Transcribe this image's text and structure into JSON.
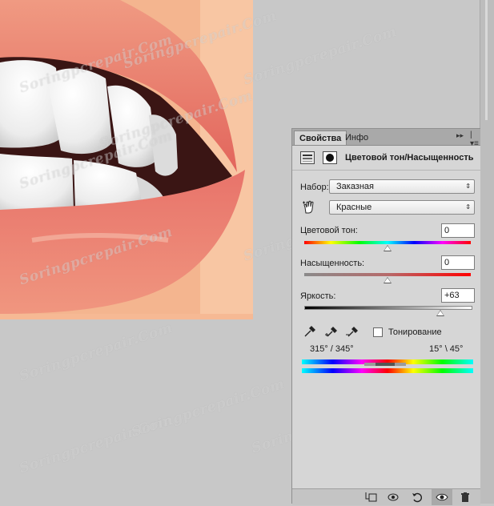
{
  "watermark_text": "Soringpcrepair.Com",
  "panel": {
    "tab_properties": "Свойства",
    "tab_info": "Инфо",
    "collapse_glyph": "▸▸",
    "menu_glyph": "|▾≡",
    "title": "Цветовой тон/Насыщенность",
    "preset_label": "Набор:",
    "preset_value": "Заказная",
    "channel_value": "Красные",
    "hue_label": "Цветовой тон:",
    "hue_value": "0",
    "saturation_label": "Насыщенность:",
    "saturation_value": "0",
    "lightness_label": "Яркость:",
    "lightness_value": "+63",
    "colorize_label": "Тонирование",
    "range_left": "315° / 345°",
    "range_right": "15° \\ 45°",
    "hue_slider_fraction": 0.5,
    "saturation_slider_fraction": 0.5,
    "lightness_slider_fraction": 0.815
  },
  "colors": {
    "panel_bg": "#d6d6d6",
    "tabbar_bg": "#a9a9a9",
    "workspace_bg": "#c8c8c8",
    "lip": "#e1655c",
    "skin": "#f3b28c"
  },
  "icons": {
    "adjustment": "hue-saturation-adjustment-icon",
    "mask": "layer-mask-icon",
    "hand": "on-image-adjust-hand-icon",
    "eyedropper": "eyedropper-icon",
    "eyedropper_plus": "eyedropper-add-icon",
    "eyedropper_minus": "eyedropper-subtract-icon",
    "footer": [
      "clip-to-layer-icon",
      "view-previous-state-icon",
      "reset-icon",
      "visibility-eye-icon",
      "trash-icon"
    ]
  }
}
